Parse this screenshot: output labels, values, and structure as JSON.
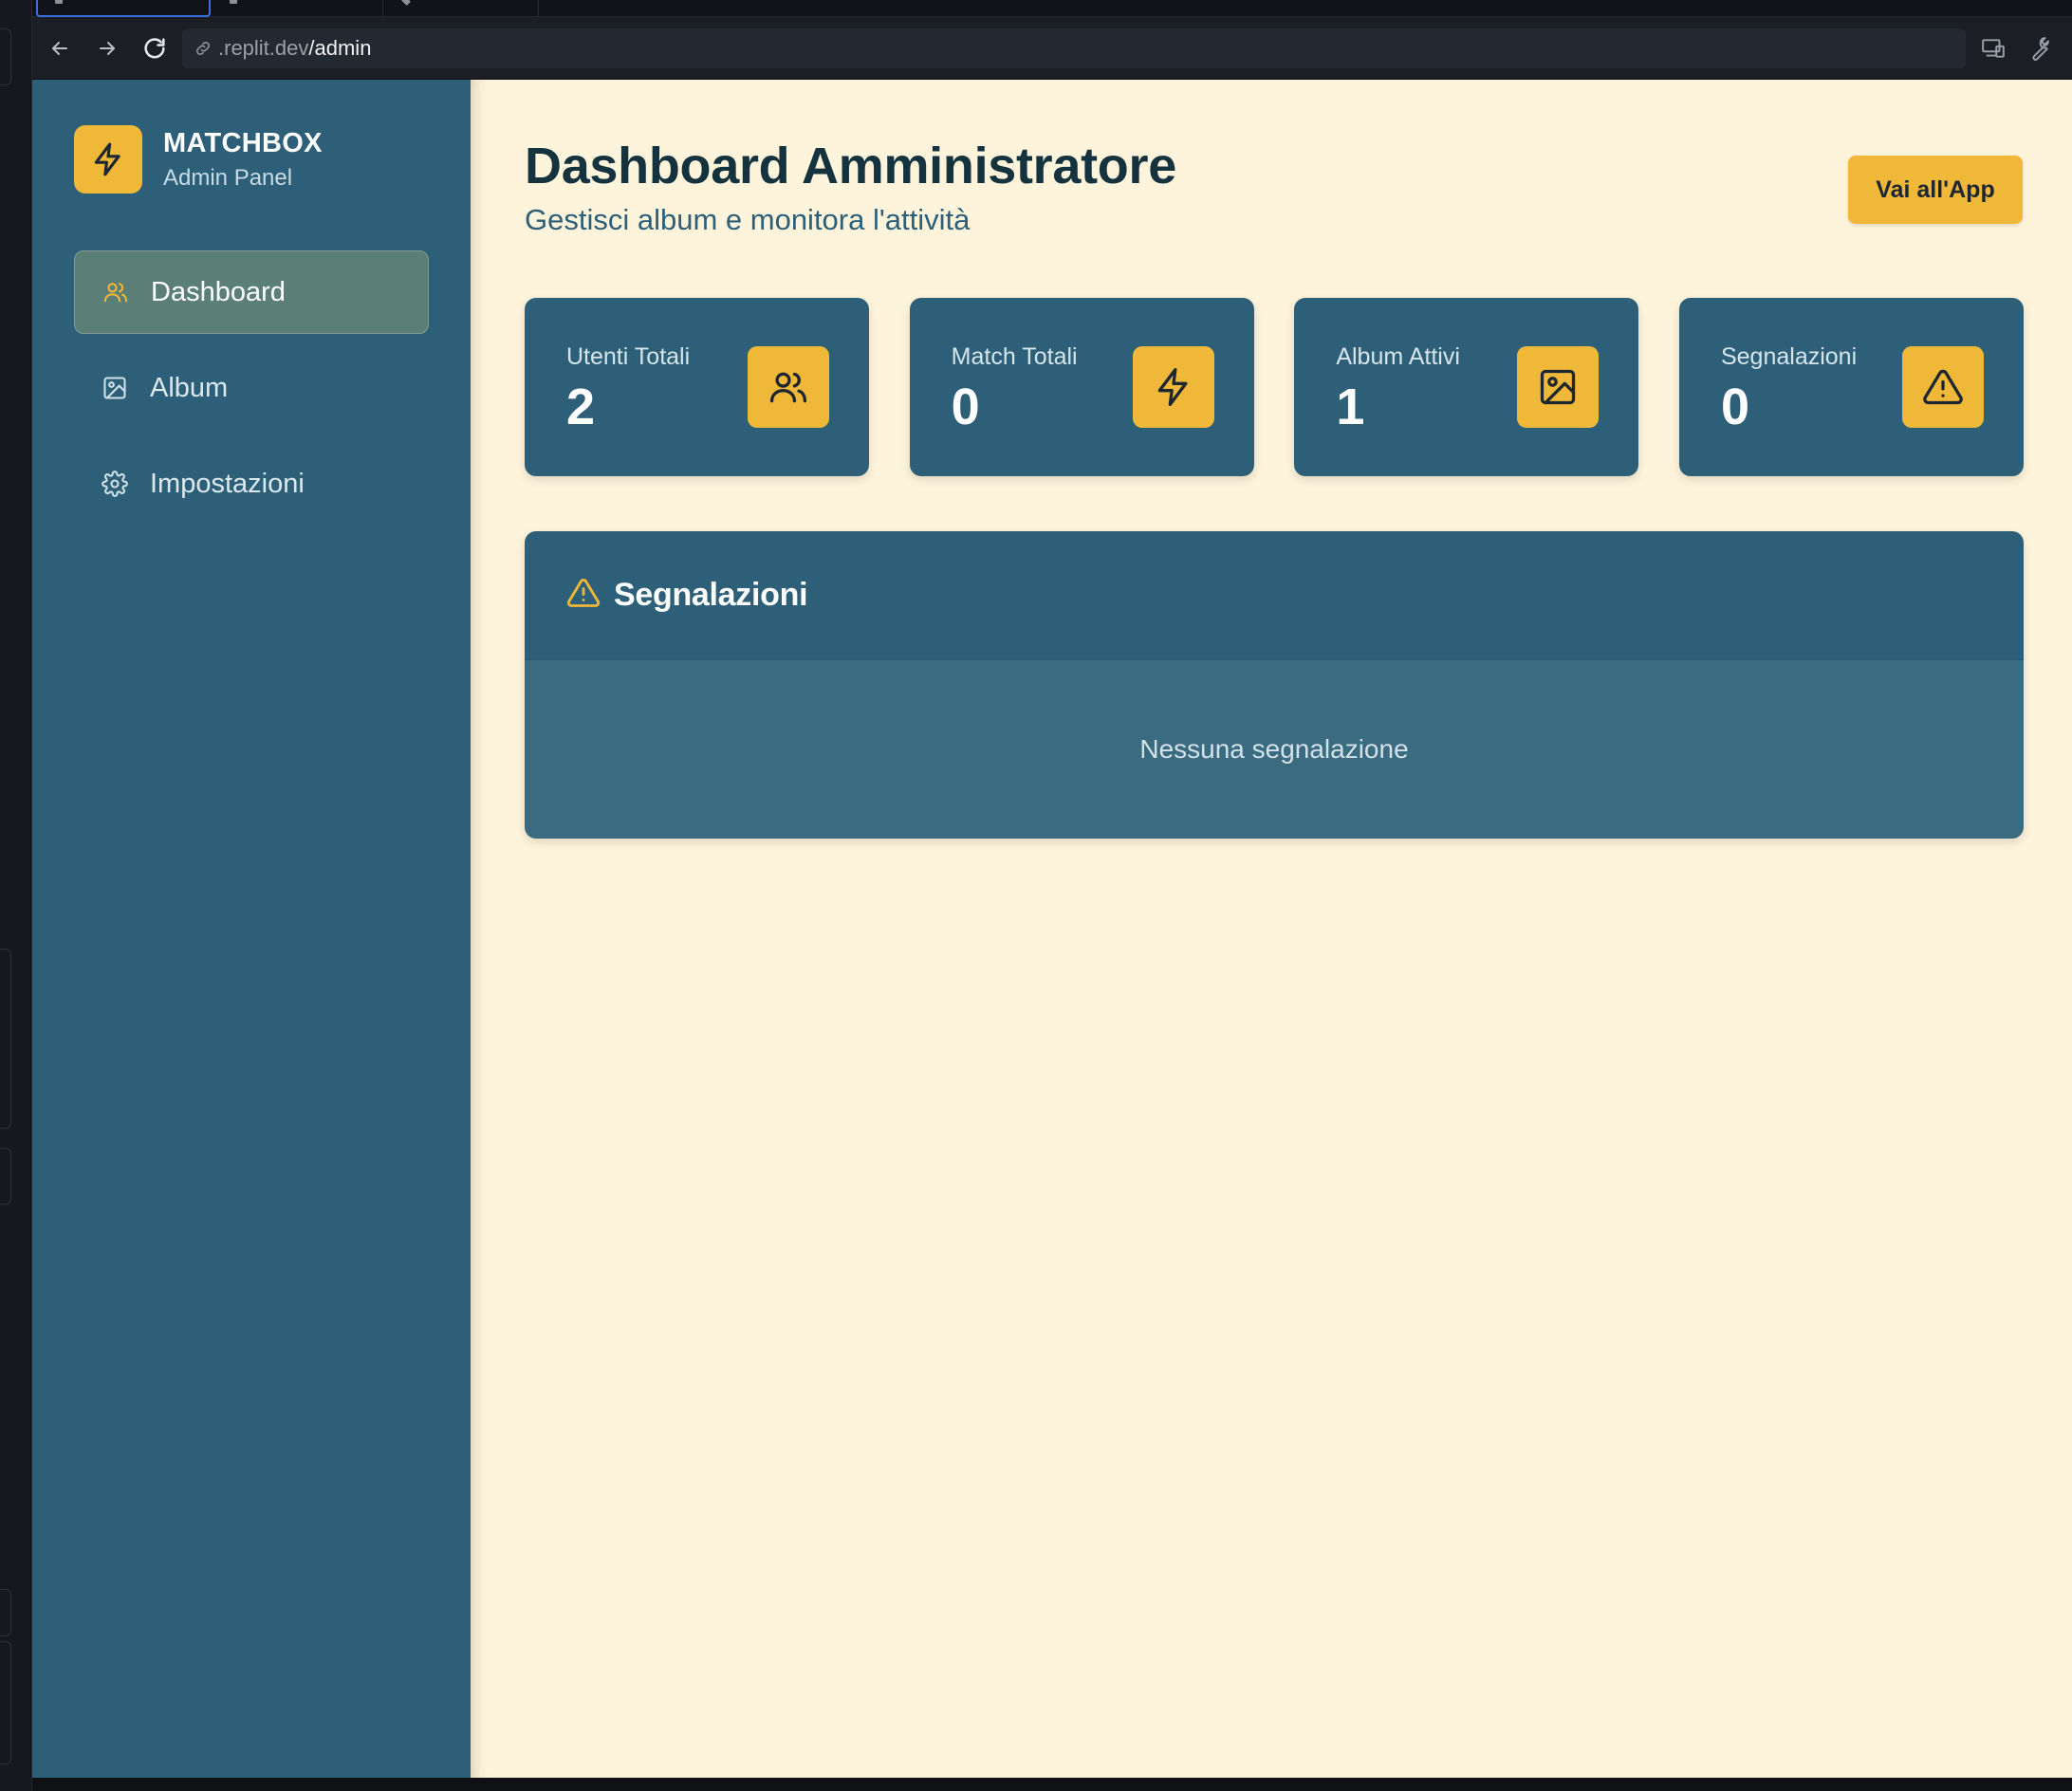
{
  "browser": {
    "url_host": ".replit.dev",
    "url_path": "/admin"
  },
  "brand": {
    "name": "MATCHBOX",
    "subtitle": "Admin Panel"
  },
  "sidebar": {
    "items": [
      {
        "label": "Dashboard",
        "icon": "users-icon",
        "active": true
      },
      {
        "label": "Album",
        "icon": "image-icon",
        "active": false
      },
      {
        "label": "Impostazioni",
        "icon": "gear-icon",
        "active": false
      }
    ]
  },
  "header": {
    "title": "Dashboard Amministratore",
    "subtitle": "Gestisci album e monitora l'attività",
    "app_button": "Vai all'App"
  },
  "stats": [
    {
      "label": "Utenti Totali",
      "value": "2",
      "icon": "users-icon"
    },
    {
      "label": "Match Totali",
      "value": "0",
      "icon": "lightning-icon"
    },
    {
      "label": "Album Attivi",
      "value": "1",
      "icon": "image-icon"
    },
    {
      "label": "Segnalazioni",
      "value": "0",
      "icon": "warning-icon"
    }
  ],
  "reports": {
    "title": "Segnalazioni",
    "empty_text": "Nessuna segnalazione"
  },
  "colors": {
    "sidebar": "#2d6078",
    "accent": "#efb838",
    "page_background": "#fef4dc",
    "title_text": "#15323f"
  }
}
